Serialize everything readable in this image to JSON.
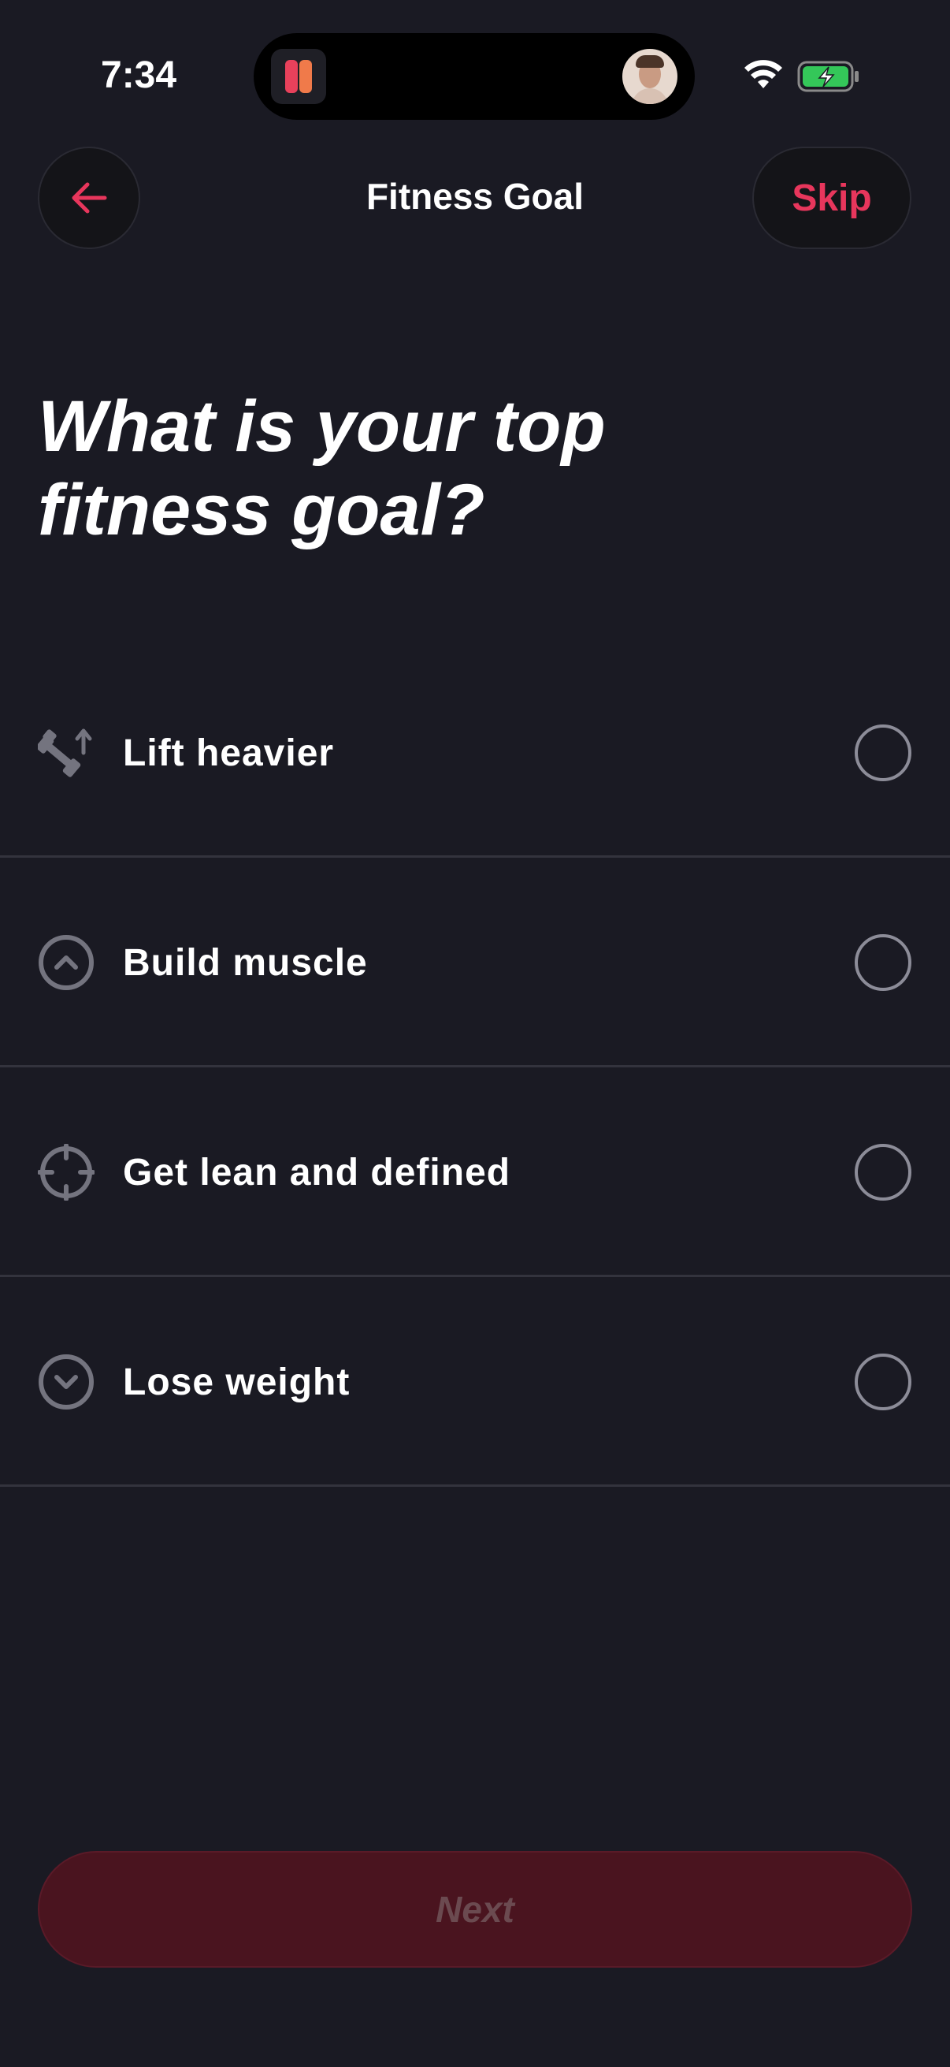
{
  "status_bar": {
    "time": "7:34",
    "battery_color": "#34c759"
  },
  "header": {
    "back_icon": "arrow-left-icon",
    "title": "Fitness Goal",
    "skip_label": "Skip"
  },
  "question": "What is your top fitness goal?",
  "options": [
    {
      "label": "Lift heavier",
      "icon": "dumbbell-up-icon",
      "selected": false
    },
    {
      "label": "Build muscle",
      "icon": "chevron-up-circle-icon",
      "selected": false
    },
    {
      "label": "Get lean and defined",
      "icon": "crosshair-icon",
      "selected": false
    },
    {
      "label": "Lose weight",
      "icon": "chevron-down-circle-icon",
      "selected": false
    }
  ],
  "next_label": "Next",
  "colors": {
    "accent": "#e8365c",
    "background": "#1a1a23",
    "disabled_button": "#4a141f"
  }
}
